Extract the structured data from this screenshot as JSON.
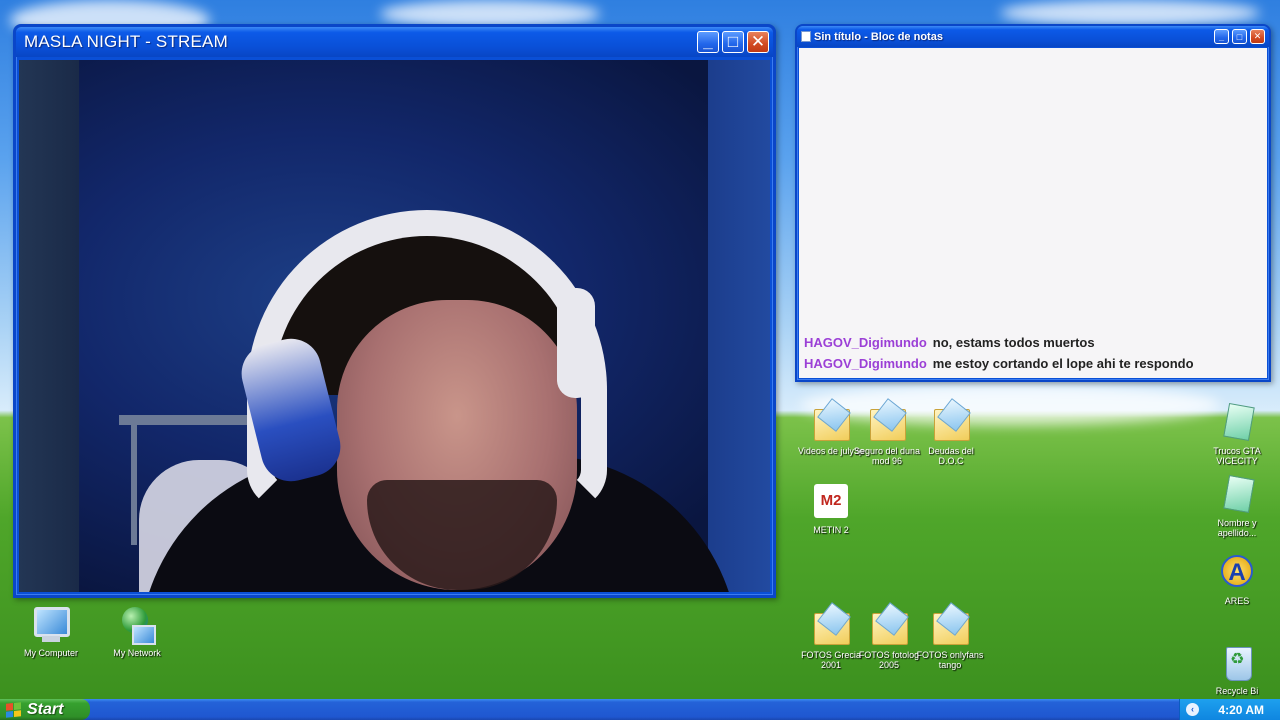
{
  "stream_window": {
    "title": "MASLA NIGHT - STREAM",
    "minimize_glyph": "_",
    "maximize_glyph": "□",
    "close_glyph": "✕"
  },
  "notepad": {
    "title": "Sin título - Bloc de notas",
    "minimize_glyph": "_",
    "maximize_glyph": "□",
    "close_glyph": "✕",
    "chat": [
      {
        "user": "HAGOV_Digimundo",
        "message": "no, estams todos muertos"
      },
      {
        "user": "HAGOV_Digimundo",
        "message": "me estoy cortando el lope ahi te respondo"
      }
    ]
  },
  "desktop_icons": {
    "my_computer": "My Computer",
    "my_network": "My Network",
    "videos": "Videos de july3p",
    "seguro": "Seguro del duna mod 96",
    "deudas": "Deudas del D.O.C",
    "metin": "METIN 2",
    "fotos_grecia": "FOTOS Grecia 2001",
    "fotos_fotolog": "FOTOS fotolog 2005",
    "fotos_onlyfans": "FOTOS onlyfans tango",
    "trucos": "Trucos GTA VICECITY",
    "nombre": "Nombre y apellido...",
    "ares": "ARES",
    "recycle": "Recycle Bi"
  },
  "taskbar": {
    "start_label": "Start",
    "tray_arrow": "‹",
    "clock": "4:20 AM"
  },
  "colors": {
    "chat_username": "#9b3fd6",
    "titlebar_blue": "#0a4fd6",
    "start_green": "#36a12f"
  }
}
